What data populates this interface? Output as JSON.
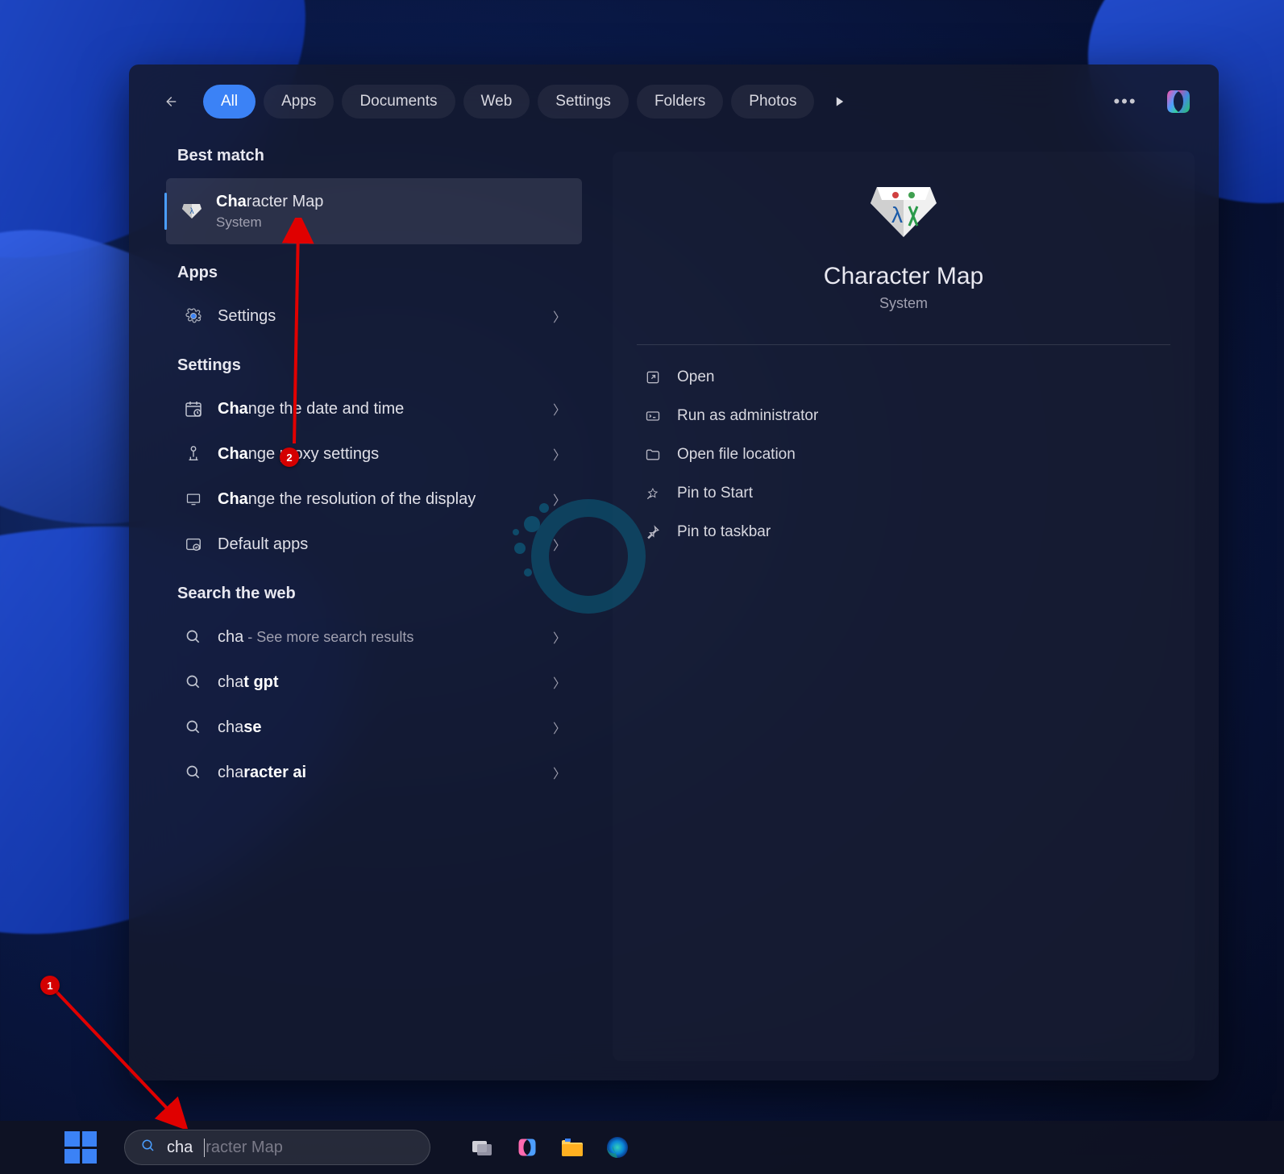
{
  "filters": {
    "all": "All",
    "apps": "Apps",
    "documents": "Documents",
    "web": "Web",
    "settings": "Settings",
    "folders": "Folders",
    "photos": "Photos"
  },
  "sections": {
    "best_match": "Best match",
    "apps": "Apps",
    "settings": "Settings",
    "search_web": "Search the web"
  },
  "best_match": {
    "title_prefix": "Cha",
    "title_rest": "racter Map",
    "subtitle": "System"
  },
  "apps_list": [
    {
      "label": "Settings"
    }
  ],
  "settings_list": [
    {
      "prefix": "Cha",
      "rest": "nge the date and time"
    },
    {
      "prefix": "Cha",
      "rest": "nge proxy settings"
    },
    {
      "prefix": "Cha",
      "rest": "nge the resolution of the display"
    },
    {
      "prefix": "",
      "rest": "Default apps"
    }
  ],
  "web_list": [
    {
      "text": "cha",
      "suffix": " - See more search results"
    },
    {
      "text": "cha",
      "bold_suffix": "t gpt"
    },
    {
      "text": "cha",
      "bold_suffix": "se"
    },
    {
      "text": "cha",
      "bold_suffix": "racter ai"
    }
  ],
  "preview": {
    "title": "Character Map",
    "subtitle": "System",
    "actions": [
      "Open",
      "Run as administrator",
      "Open file location",
      "Pin to Start",
      "Pin to taskbar"
    ]
  },
  "search_box": {
    "typed": "cha",
    "ghost": "racter Map"
  },
  "annotations": {
    "badge1": "1",
    "badge2": "2"
  }
}
